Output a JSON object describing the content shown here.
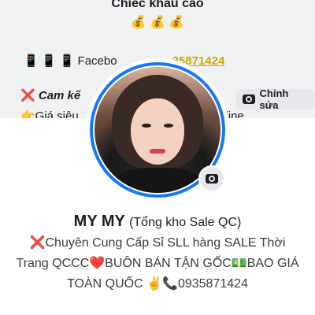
{
  "cover": {
    "line1": "Chiếc khẩu cao",
    "line2": "💰 💰 💰",
    "line3_prefix": "📱 📱 📱  Facebo",
    "line3_phone": "35871424",
    "line4_text": "Cam kế",
    "line5": "👉Giá siêu",
    "line5_right": "online"
  },
  "cover_edit": {
    "label": "Chỉnh sửa",
    "icon": "camera-icon"
  },
  "avatar": {
    "edit_icon": "camera-icon"
  },
  "profile": {
    "name": "MY MY",
    "alt_name": "(Tổng kho Sale QC)"
  },
  "bio": {
    "line1_a": "❌Chuyên Cung Cấp Sỉ SLL hàng SALE Thời",
    "line2_a": "Trang QCCC❤️BUÔN BÁN TẬN GỐC💵BAO GIÁ",
    "line3_a": "TOÀN QUỐC ✌️📞0935871424"
  },
  "colors": {
    "accent": "#1877f2",
    "text": "#1c1e21",
    "button_bg": "#e6e8eb"
  }
}
